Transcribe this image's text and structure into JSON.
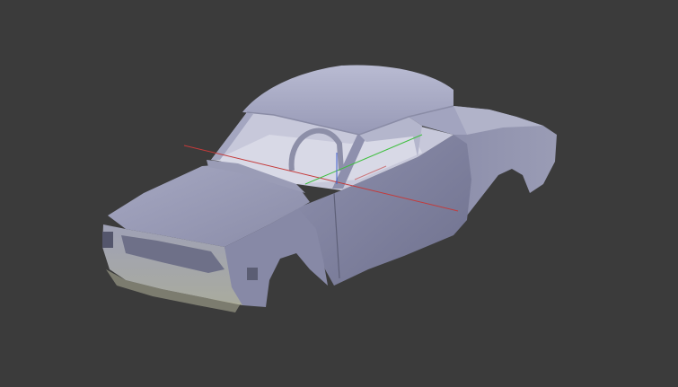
{
  "viewport": {
    "background_color": "#3b3b3b",
    "model": "car-body-shell",
    "shading": "solid",
    "axes": {
      "x_color": "#c43a3a",
      "y_color": "#3fbf3f",
      "z_color": "#4060d0"
    },
    "body_color": "#9a9cb8"
  }
}
